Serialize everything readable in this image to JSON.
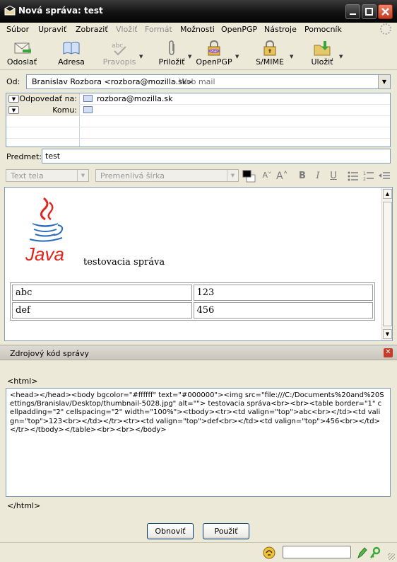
{
  "window": {
    "title": "Nová správa: test"
  },
  "menu": {
    "items": [
      "Súbor",
      "Upraviť",
      "Zobraziť",
      "Vložiť",
      "Formát",
      "Možnosti",
      "OpenPGP",
      "Nástroje",
      "Pomocník"
    ]
  },
  "toolbar": {
    "send": "Odoslať",
    "address": "Adresa",
    "spell": "Pravopis",
    "attach": "Priložiť",
    "openpgp": "OpenPGP",
    "smime": "S/MIME",
    "save": "Uložiť"
  },
  "header": {
    "from_label": "Od:",
    "from_value": "Branislav Rozbora <rozbora@mozilla.sk>",
    "from_suffix": "- Web mail",
    "recipients": [
      {
        "type": "Odpovedať na:",
        "value": "rozbora@mozilla.sk"
      },
      {
        "type": "Komu:",
        "value": ""
      }
    ],
    "subject_label": "Predmet:",
    "subject_value": "test"
  },
  "format": {
    "paragraph": "Text tela",
    "font": "Premenlivá šírka"
  },
  "editor": {
    "logo_text": "Java",
    "message": "testovacia správa",
    "table": [
      [
        "abc",
        "123"
      ],
      [
        "def",
        "456"
      ]
    ]
  },
  "source_panel": {
    "title": "Zdrojový kód správy",
    "open_tag": "<html>",
    "code": "<head></head><body bgcolor=\"#ffffff\" text=\"#000000\"><img src=\"file:///C:/Documents%20and%20Settings/Branislav/Desktop/thumbnail-5028.jpg\" alt=\"\"> testovacia správa<br><br><table border=\"1\" cellpadding=\"2\" cellspacing=\"2\" width=\"100%\"><tbody><tr><td valign=\"top\">abc<br></td><td valign=\"top\">123<br></td></tr><tr><td valign=\"top\">def<br></td><td valign=\"top\">456<br></td></tr></tbody></table><br><br></body>",
    "close_tag": "</html>",
    "refresh_button": "Obnoviť",
    "apply_button": "Použiť"
  },
  "colors": {
    "accent": "#316ac5",
    "close": "#c83a2a",
    "java_red": "#e2231a",
    "java_blue": "#2a6ebb"
  }
}
